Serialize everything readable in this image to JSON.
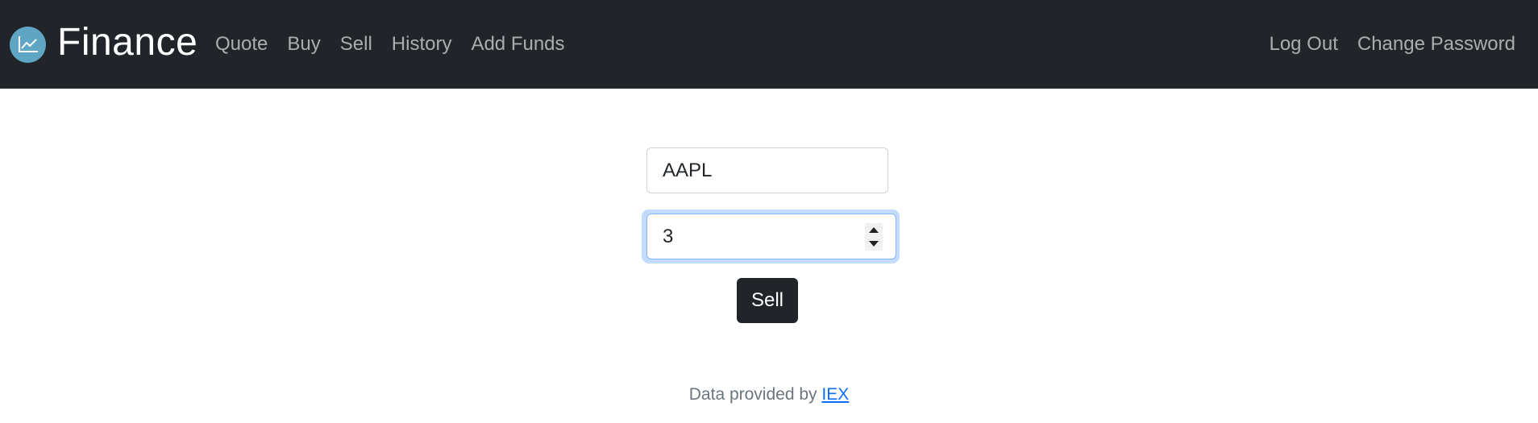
{
  "navbar": {
    "brand": "Finance",
    "brand_icon": "chart-line-icon",
    "left_links": [
      "Quote",
      "Buy",
      "Sell",
      "History",
      "Add Funds"
    ],
    "right_links": [
      "Log Out",
      "Change Password"
    ],
    "background": "#212529"
  },
  "form": {
    "symbol_value": "AAPL",
    "shares_value": "3",
    "submit_label": "Sell"
  },
  "footer": {
    "text": "Data provided by",
    "link_text": "IEX"
  },
  "colors": {
    "brand_icon_bg": "#5ea6c4",
    "link": "#0d6efd",
    "focus_ring": "#86b7fe"
  }
}
